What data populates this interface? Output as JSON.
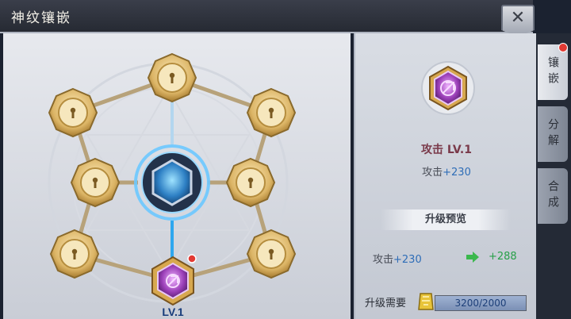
{
  "window": {
    "title": "神纹镶嵌",
    "close_label": "✕"
  },
  "board": {
    "slots": [
      {
        "id": "top",
        "state": "locked"
      },
      {
        "id": "upper-left",
        "state": "locked"
      },
      {
        "id": "upper-right",
        "state": "locked"
      },
      {
        "id": "mid-left",
        "state": "locked"
      },
      {
        "id": "mid-right",
        "state": "locked"
      },
      {
        "id": "lower-left",
        "state": "locked"
      },
      {
        "id": "lower-right",
        "state": "locked"
      },
      {
        "id": "bottom",
        "state": "equipped",
        "level_label": "LV.1",
        "has_alert": true
      }
    ],
    "center": {
      "state": "core"
    }
  },
  "detail": {
    "name": "攻击 LV.1",
    "stat_label": "攻击",
    "stat_value": "+230",
    "preview_title": "升级预览",
    "upgrade_from_label": "攻击",
    "upgrade_from_value": "+230",
    "upgrade_to_value": "+288",
    "cost_label": "升级需要",
    "cost_text": "3200/2000",
    "cost_progress": 1.0
  },
  "tabs": [
    {
      "label": "镶嵌",
      "active": true,
      "has_alert": true
    },
    {
      "label": "分解",
      "active": false
    },
    {
      "label": "合成",
      "active": false
    }
  ],
  "colors": {
    "stat_blue": "#2e6db7",
    "stat_green": "#27a048",
    "gem_purple": "#8e3aa6",
    "slot_gold": "#d6b25e",
    "core_blue": "#3aa0e6"
  }
}
